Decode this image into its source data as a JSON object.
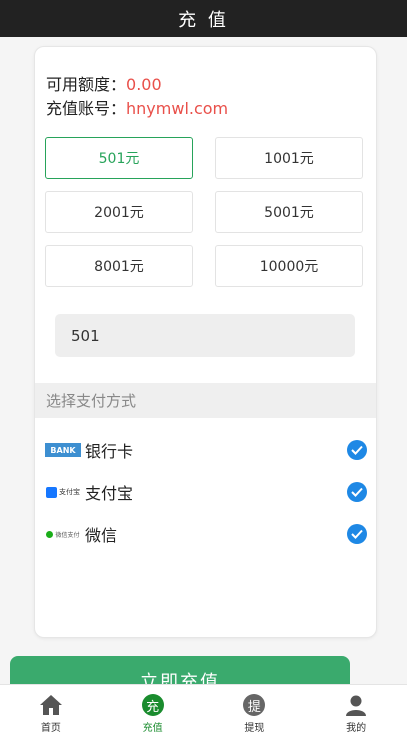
{
  "header": {
    "title": "充 值"
  },
  "info": {
    "balance_label": "可用额度：",
    "balance_value": "0.00",
    "account_label": "充值账号：",
    "account_value": "hnymwl.com"
  },
  "amounts": [
    "501元",
    "1001元",
    "2001元",
    "5001元",
    "8001元",
    "10000元"
  ],
  "selected_amount_index": 0,
  "custom_amount": {
    "value": "501"
  },
  "payment": {
    "section_title": "选择支付方式",
    "methods": [
      {
        "name": "银行卡",
        "logo_text": "BANK",
        "checked": true
      },
      {
        "name": "支付宝",
        "logo_text": "支付宝",
        "checked": true
      },
      {
        "name": "微信",
        "logo_text": "微信支付",
        "checked": true
      }
    ]
  },
  "submit_label": "立即充值",
  "tabs": [
    {
      "label": "首页",
      "icon": "home-icon"
    },
    {
      "label": "充值",
      "icon": "recharge-icon",
      "glyph": "充",
      "active": true
    },
    {
      "label": "提现",
      "icon": "withdraw-icon",
      "glyph": "提"
    },
    {
      "label": "我的",
      "icon": "user-icon"
    }
  ],
  "colors": {
    "accent": "#27a35a",
    "value_red": "#e9504a",
    "check_blue": "#1e88e5",
    "submit_green": "#3aaa6d"
  }
}
